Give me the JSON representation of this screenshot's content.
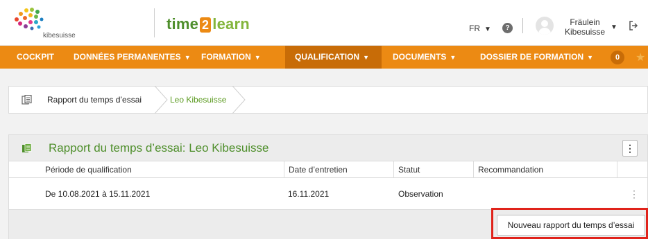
{
  "header": {
    "logo_text": "kibesuisse",
    "brand_part1": "time",
    "brand_part2": "2",
    "brand_part3": "learn",
    "language": "FR",
    "help_icon": "question-icon",
    "user_name_line1": "Fräulein",
    "user_name_line2": "Kibesuisse"
  },
  "nav": {
    "items": [
      {
        "label": "COCKPIT",
        "has_caret": false
      },
      {
        "label": "DONNÉES PERMANENTES",
        "has_caret": true
      },
      {
        "label": "FORMATION",
        "has_caret": true
      },
      {
        "label": "QUALIFICATION",
        "has_caret": true,
        "active": true
      },
      {
        "label": "DOCUMENTS",
        "has_caret": true
      },
      {
        "label": "DOSSIER DE FORMATION",
        "has_caret": true
      }
    ],
    "badge_count": "0"
  },
  "breadcrumb": {
    "item1": "Rapport du temps d’essai",
    "item2": "Leo Kibesuisse"
  },
  "panel": {
    "title": "Rapport du temps d’essai: Leo Kibesuisse",
    "columns": [
      "Période de qualification",
      "Date d’entretien",
      "Statut",
      "Recommandation"
    ],
    "rows": [
      {
        "period": "De 10.08.2021 à 15.11.2021",
        "date": "16.11.2021",
        "status": "Observation",
        "recommendation": ""
      }
    ],
    "new_button": "Nouveau rapport du temps d’essai"
  },
  "colors": {
    "nav_bg": "#ec8a13",
    "nav_active": "#c86c07",
    "accent_green": "#4f8f2c",
    "highlight_red": "#e0231b"
  }
}
